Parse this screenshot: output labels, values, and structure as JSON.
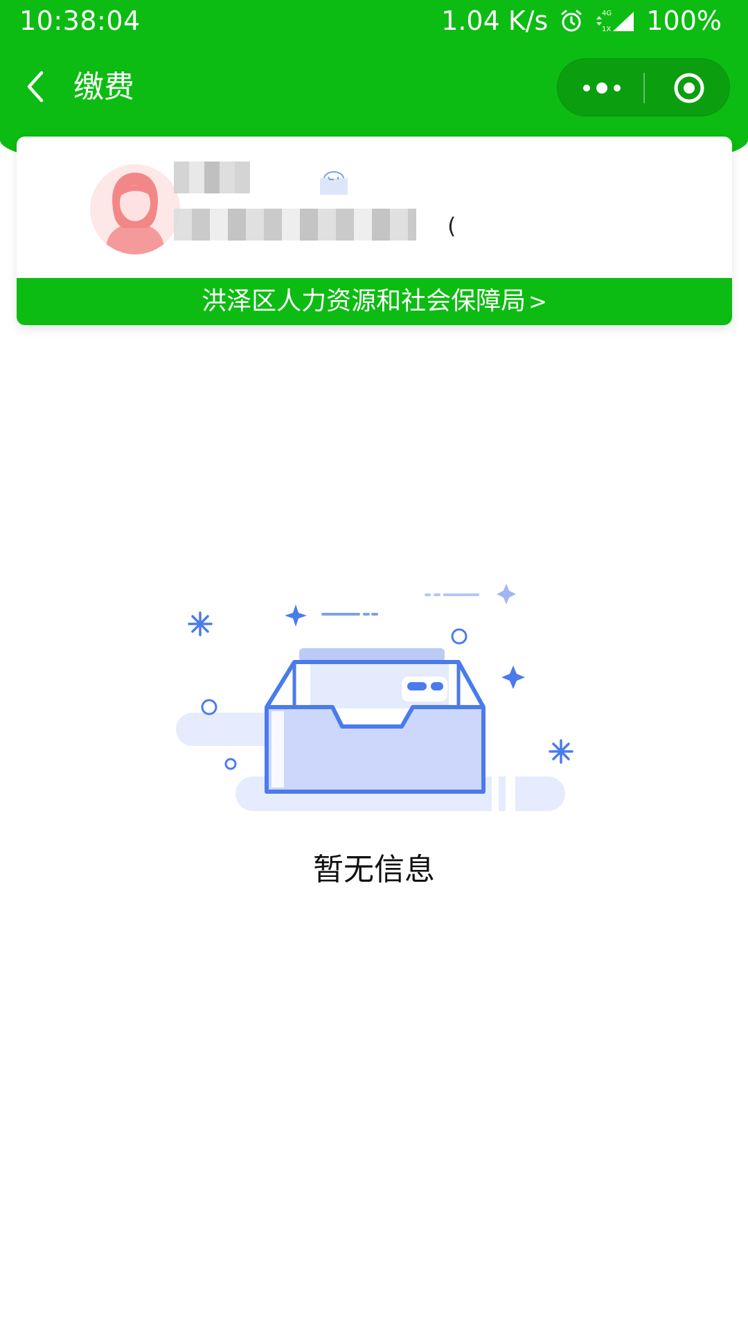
{
  "status_bar": {
    "time": "10:38:04",
    "network_speed": "1.04 K/s",
    "battery": "100%",
    "icons": [
      "alarm-icon",
      "signal-4g-icon"
    ]
  },
  "nav": {
    "title": "缴费",
    "back_icon": "chevron-left-icon",
    "more_icon": "more-dots-icon",
    "close_icon": "target-close-icon"
  },
  "user_card": {
    "name": "",
    "id_number": "",
    "name_tail": "",
    "id_tail": "(",
    "avatar_icon": "female-avatar-icon",
    "badge_icon": "verified-badge-icon",
    "agency": "洪泽区人力资源和社会保障局",
    "agency_chevron": ">"
  },
  "empty_state": {
    "message": "暂无信息",
    "illustration": "empty-inbox-illustration"
  },
  "colors": {
    "header_green": "#0cbc12",
    "capsule_green": "#0b9f10",
    "illustration_blue": "#4a7bec",
    "illustration_fill": "#cdd6fb"
  }
}
